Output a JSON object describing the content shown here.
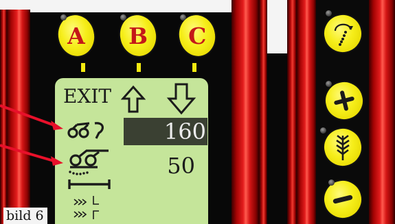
{
  "keys": [
    {
      "label": "A"
    },
    {
      "label": "B"
    },
    {
      "label": "C"
    }
  ],
  "display": {
    "exit_label": "EXIT",
    "up_arrow": "up-arrow-icon",
    "down_arrow": "down-arrow-icon",
    "rows": [
      {
        "icon": "tine-spring-icon",
        "value": "160",
        "selected": true
      },
      {
        "icon": "wheel-rake-icon",
        "value": "50",
        "selected": false
      },
      {
        "icon": "width-bracket-icon",
        "value": ""
      },
      {
        "icon": "speed-steps-icon",
        "value": ""
      }
    ]
  },
  "right_buttons": [
    {
      "icon": "rotate-dots-icon"
    },
    {
      "icon": "plus-icon"
    },
    {
      "icon": "wheat-ear-icon"
    },
    {
      "icon": "minus-icon"
    }
  ],
  "caption": "bild 6",
  "colors": {
    "panel": "#080808",
    "rail_red": "#e21c1c",
    "key_yellow": "#f6ee1a",
    "key_letter": "#c41818",
    "lcd_green": "#c5e59a",
    "selection": "#3a4032",
    "pointer_arrow": "#e8102a"
  }
}
